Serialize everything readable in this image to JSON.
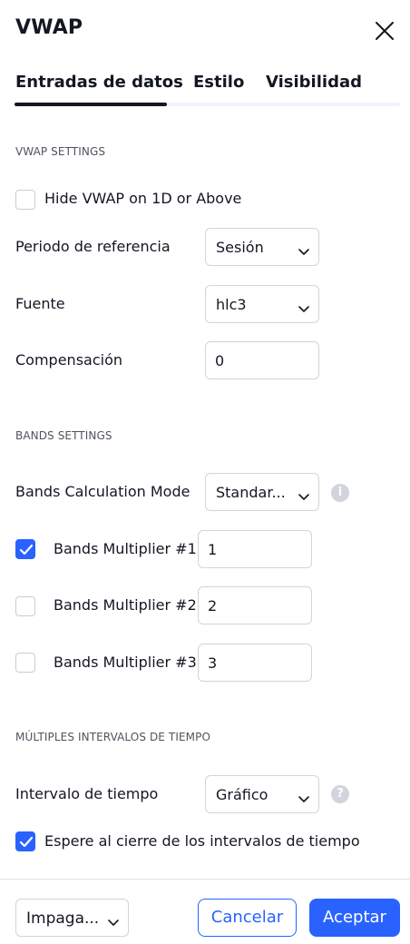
{
  "header": {
    "title": "VWAP",
    "close_icon": "close-icon"
  },
  "tabs": [
    {
      "label": "Entradas de datos",
      "active": true
    },
    {
      "label": "Estilo",
      "active": false
    },
    {
      "label": "Visibilidad",
      "active": false
    }
  ],
  "vwap_settings": {
    "section_title": "VWAP SETTINGS",
    "hide_vwap": {
      "label": "Hide VWAP on 1D or Above",
      "checked": false
    },
    "anchor_period": {
      "label": "Periodo de referencia",
      "value": "Sesión"
    },
    "source": {
      "label": "Fuente",
      "value": "hlc3"
    },
    "offset": {
      "label": "Compensación",
      "value": "0"
    }
  },
  "bands_settings": {
    "section_title": "BANDS SETTINGS",
    "calc_mode": {
      "label": "Bands Calculation Mode",
      "value": "Standar..."
    },
    "multipliers": [
      {
        "label": "Bands Multiplier #1",
        "value": "1",
        "checked": true
      },
      {
        "label": "Bands Multiplier #2",
        "value": "2",
        "checked": false
      },
      {
        "label": "Bands Multiplier #3",
        "value": "3",
        "checked": false
      }
    ]
  },
  "timeframe_settings": {
    "section_title": "MÚLTIPLES INTERVALOS DE TIEMPO",
    "timeframe": {
      "label": "Intervalo de tiempo",
      "value": "Gráfico"
    },
    "wait_close": {
      "label": "Espere al cierre de los intervalos de tiempo",
      "checked": true
    }
  },
  "footer": {
    "defaults": "Impaga...",
    "cancel": "Cancelar",
    "accept": "Aceptar"
  },
  "colors": {
    "accent": "#2962ff",
    "text": "#131722",
    "border": "#d1d4dc"
  }
}
